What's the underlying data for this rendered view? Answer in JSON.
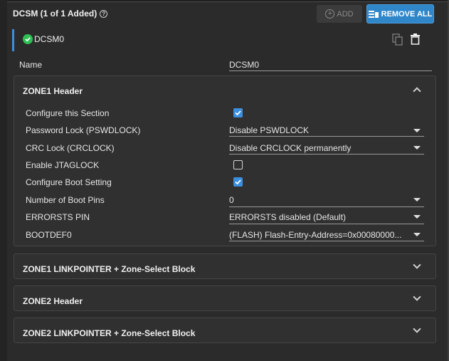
{
  "header": {
    "title": "DCSM (1 of 1 Added)",
    "help_glyph": "?"
  },
  "toolbar": {
    "add_label": "ADD",
    "remove_all_label": "REMOVE ALL"
  },
  "instance": {
    "name": "DCSM0",
    "status": "valid"
  },
  "name_field": {
    "label": "Name",
    "value": "DCSM0"
  },
  "zone1_header": {
    "title": "ZONE1 Header",
    "expanded": true,
    "rows": [
      {
        "label": "Configure this Section",
        "type": "checkbox",
        "checked": true
      },
      {
        "label": "Password Lock (PSWDLOCK)",
        "type": "select",
        "value": "Disable PSWDLOCK"
      },
      {
        "label": "CRC Lock (CRCLOCK)",
        "type": "select",
        "value": "Disable CRCLOCK permanently"
      },
      {
        "label": "Enable JTAGLOCK",
        "type": "checkbox",
        "checked": false
      },
      {
        "label": "Configure Boot Setting",
        "type": "checkbox",
        "checked": true
      },
      {
        "label": "Number of Boot Pins",
        "type": "select",
        "value": "0"
      },
      {
        "label": "ERRORSTS PIN",
        "type": "select",
        "value": "ERRORSTS disabled (Default)"
      },
      {
        "label": "BOOTDEF0",
        "type": "select",
        "value": "(FLASH) Flash-Entry-Address=0x00080000..."
      }
    ]
  },
  "collapsed_panels": [
    {
      "title": "ZONE1 LINKPOINTER + Zone-Select Block"
    },
    {
      "title": "ZONE2 Header"
    },
    {
      "title": "ZONE2 LINKPOINTER + Zone-Select Block"
    }
  ],
  "colors": {
    "accent": "#2f86c9",
    "success": "#2fbf55",
    "background": "#2b2b2b"
  }
}
